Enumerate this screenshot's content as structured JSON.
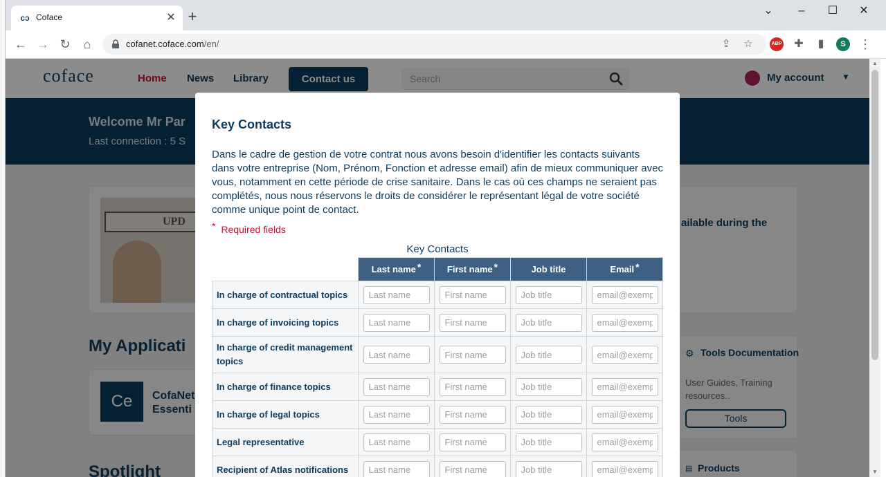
{
  "browser": {
    "tab": {
      "title": "Coface",
      "favicon": "coface-logo-icon"
    },
    "url": {
      "host": "cofanet.coface.com",
      "path": "/en/"
    },
    "extensions": [
      {
        "name": "abp",
        "label": "ABP",
        "color": "#d5261f"
      },
      {
        "name": "profile",
        "label": "S",
        "color": "#0f7b5f"
      }
    ]
  },
  "site": {
    "logo": "coface",
    "nav": [
      {
        "label": "Home",
        "active": true
      },
      {
        "label": "News"
      },
      {
        "label": "Library"
      }
    ],
    "contact_button": "Contact us",
    "search": {
      "placeholder": "Search"
    },
    "account_label": "My account"
  },
  "banner": {
    "welcome": "Welcome Mr Par",
    "last_connection": "Last connection : 5 S"
  },
  "background": {
    "update_image_text": "UPD",
    "availability_text": "ailable during the",
    "my_applications_title": "My Applicati",
    "app_tile": {
      "abbr": "Ce",
      "name_line1": "CofaNet",
      "name_line2": "Essenti"
    },
    "tools": {
      "title": "Tools Documentation",
      "description": "User Guides, Training resources..",
      "button": "Tools"
    },
    "spotlight_title": "Spotlight",
    "products_title": "Products"
  },
  "modal": {
    "title": "Key Contacts",
    "description": "Dans le cadre de gestion de votre contrat nous avons besoin d'identifier les contacts suivants dans votre entreprise (Nom, Prénom, Fonction et adresse email) afin de mieux communiquer avec vous, notamment en cette période de crise sanitaire. Dans le cas où ces champs ne seraient pas complétés, nous nous réservons le droits de considérer le représentant légal de votre société comme unique point de contact.",
    "required_note": "Required fields",
    "table": {
      "caption": "Key Contacts",
      "columns": [
        {
          "label": "Last name",
          "required": true
        },
        {
          "label": "First name",
          "required": true
        },
        {
          "label": "Job title",
          "required": false
        },
        {
          "label": "Email",
          "required": true
        }
      ],
      "placeholders": [
        "Last name",
        "First name",
        "Job title",
        "email@exemple.com"
      ],
      "rows": [
        {
          "label": "In charge of contractual topics"
        },
        {
          "label": "In charge of invoicing topics"
        },
        {
          "label": "In charge of credit management topics",
          "tall": true
        },
        {
          "label": "In charge of finance topics"
        },
        {
          "label": "In charge of legal topics"
        },
        {
          "label": "Legal representative"
        },
        {
          "label": "Recipient of Atlas notifications"
        }
      ]
    }
  },
  "colors": {
    "brand": "#0b3c5d",
    "accent": "#c8102e",
    "table_header": "#3e6183"
  }
}
